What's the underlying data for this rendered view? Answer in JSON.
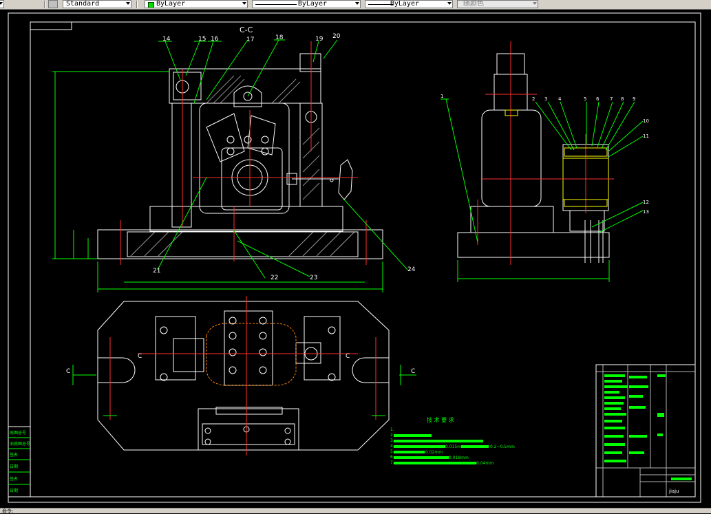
{
  "toolbar": {
    "text_style": "Standard",
    "layer_color": "ByLayer",
    "linetype": "ByLayer",
    "lineweight": "ByLayer",
    "plot_style": "随颜色"
  },
  "drawing": {
    "section_label": "C-C",
    "part_numbers": [
      "14",
      "15",
      "16",
      "17",
      "18",
      "19",
      "20",
      "1",
      "2",
      "3",
      "4",
      "5",
      "6",
      "7",
      "8",
      "9",
      "10",
      "11",
      "12",
      "13",
      "21",
      "22",
      "23",
      "24"
    ],
    "section_marks": [
      "C",
      "C",
      "C",
      "C"
    ],
    "tech_req_title": "技 术 要 求",
    "tech_req_lines": [
      "1.",
      "2.",
      "3.",
      "4.",
      "5.",
      "6.",
      "7."
    ],
    "dimension_values": [
      "0.015mm",
      "0.2~0.5mm",
      "0.02mm",
      "0.018mm",
      "0.04mm"
    ],
    "left_table_rows": [
      "底图总号",
      "旧底图总号",
      "签名",
      "日期",
      "签名",
      "日期"
    ],
    "title_block_name": "jiaju"
  },
  "status": {
    "text": "命令:"
  },
  "colors": {
    "background": "#000000",
    "outline": "#ffffff",
    "centerline": "#ff0000",
    "dimension": "#00ff00",
    "highlight": "#ffff00"
  }
}
